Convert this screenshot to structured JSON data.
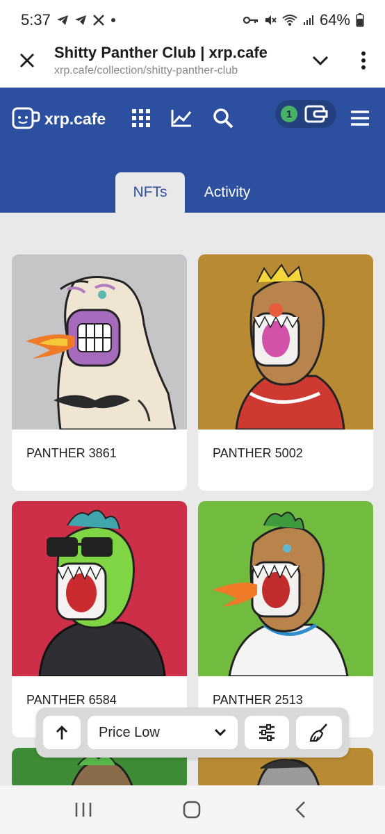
{
  "status_bar": {
    "time": "5:37",
    "battery": "64%"
  },
  "browser": {
    "title": "Shitty Panther Club | xrp.cafe",
    "url": "xrp.cafe/collection/shitty-panther-club"
  },
  "site": {
    "logo_text": "xrp.cafe",
    "wallet_count": "1",
    "tabs": [
      {
        "label": "NFTs"
      },
      {
        "label": "Activity"
      }
    ]
  },
  "nfts": [
    {
      "name": "PANTHER 3861",
      "bg": "#c5c4c6"
    },
    {
      "name": "PANTHER 5002",
      "bg": "#b98a34"
    },
    {
      "name": "PANTHER 6584",
      "bg": "#cc2f47"
    },
    {
      "name": "PANTHER 2513",
      "bg": "#71bb3e"
    }
  ],
  "toolbar": {
    "sort_value": "Price Low"
  },
  "icons": {
    "close": "close-icon",
    "chevron": "chevron-down-icon",
    "menu": "more-vert-icon",
    "grid": "grid-icon",
    "chart": "chart-icon",
    "search": "search-icon",
    "wallet": "wallet-icon",
    "hamburger": "hamburger-icon",
    "up": "arrow-up-icon",
    "filter": "sliders-icon",
    "clear": "broom-icon"
  }
}
